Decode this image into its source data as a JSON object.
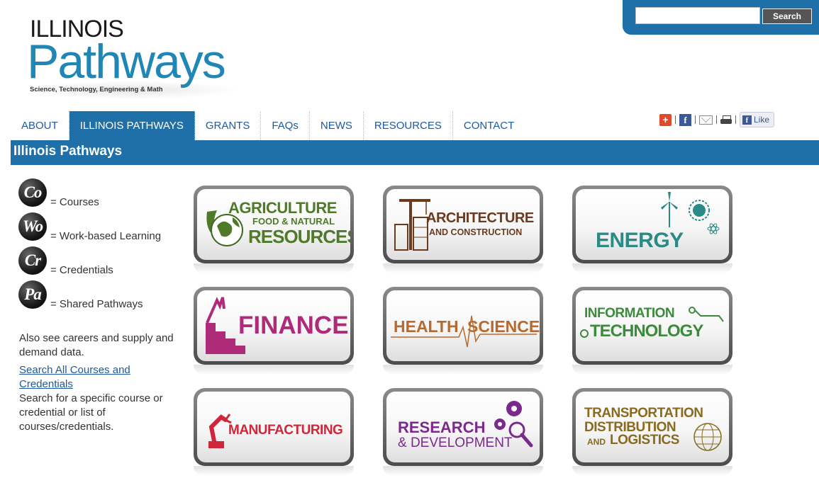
{
  "logo": {
    "line1": "ILLINOIS",
    "line2": "Pathways",
    "tagline": "Science, Technology, Engineering & Math"
  },
  "search": {
    "placeholder": "",
    "value": "",
    "button_label": "Search"
  },
  "nav": {
    "items": [
      {
        "label": "ABOUT"
      },
      {
        "label": "ILLINOIS PATHWAYS",
        "active": true
      },
      {
        "label": "GRANTS"
      },
      {
        "label": "FAQs"
      },
      {
        "label": "NEWS"
      },
      {
        "label": "RESOURCES"
      },
      {
        "label": "CONTACT"
      }
    ]
  },
  "social": {
    "plus_glyph": "+",
    "fb_glyph": "f",
    "like_label": "Like"
  },
  "section": {
    "title": "Illinois Pathways"
  },
  "legend": [
    {
      "abbr": "Co",
      "label": "= Courses"
    },
    {
      "abbr": "Wo",
      "label": "= Work-based Learning"
    },
    {
      "abbr": "Cr",
      "label": "= Credentials"
    },
    {
      "abbr": "Pa",
      "label": "= Shared Pathways"
    }
  ],
  "sidebar": {
    "also_text": "Also see careers and supply and demand data.",
    "search_link": "Search All Courses and Credentials",
    "search_desc": "Search for a specific course or credential or list of courses/credentials."
  },
  "tiles": {
    "agriculture": {
      "line1": "AGRICULTURE",
      "line2": "FOOD & NATURAL",
      "line3": "RESOURCES",
      "color": "#4e7a2a"
    },
    "architecture": {
      "line1": "ARCHITECTURE",
      "line2": "AND CONSTRUCTION",
      "color": "#6b3a1f"
    },
    "energy": {
      "line1": "ENERGY",
      "color": "#2a8a86"
    },
    "finance": {
      "line1": "FINANCE",
      "color": "#b02a7a"
    },
    "health": {
      "line1": "HEALTH",
      "line2": "SCIENCE",
      "color": "#b8692e"
    },
    "infotech": {
      "line1": "INFORMATION",
      "line2": "TECHNOLOGY",
      "color": "#3c8a3c"
    },
    "manufacturing": {
      "line1": "MANUFACTURING",
      "color": "#d0263a"
    },
    "research": {
      "line1": "RESEARCH",
      "line2": "& DEVELOPMENT",
      "color": "#7a2a8a"
    },
    "transportation": {
      "line1": "TRANSPORTATION",
      "line2": "DISTRIBUTION",
      "line3": "AND",
      "line4": "LOGISTICS",
      "color": "#8a6a1f"
    }
  }
}
